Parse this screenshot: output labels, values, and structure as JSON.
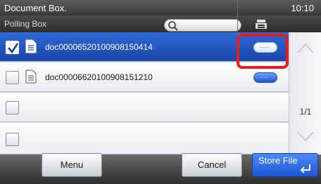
{
  "header": {
    "title": "Document Box.",
    "clock": "10:10",
    "subtitle": "Polling Box",
    "search_icon": "search-icon",
    "server_icon": "server-icon"
  },
  "list": {
    "rows": [
      {
        "name": "doc00006520100908150414",
        "checked": true,
        "selected": true
      },
      {
        "name": "doc00006620100908151210",
        "checked": false,
        "selected": false
      },
      {
        "name": "",
        "checked": false,
        "selected": false
      },
      {
        "name": "",
        "checked": false,
        "selected": false
      }
    ],
    "detail_label": "···"
  },
  "pager": {
    "page": "1/1"
  },
  "footer": {
    "menu_label": "Menu",
    "cancel_label": "Cancel",
    "store_label": "Store File"
  },
  "colors": {
    "selected_row": "#1b47a8",
    "highlight_box": "#e02020",
    "primary_button": "#1c56d4"
  }
}
